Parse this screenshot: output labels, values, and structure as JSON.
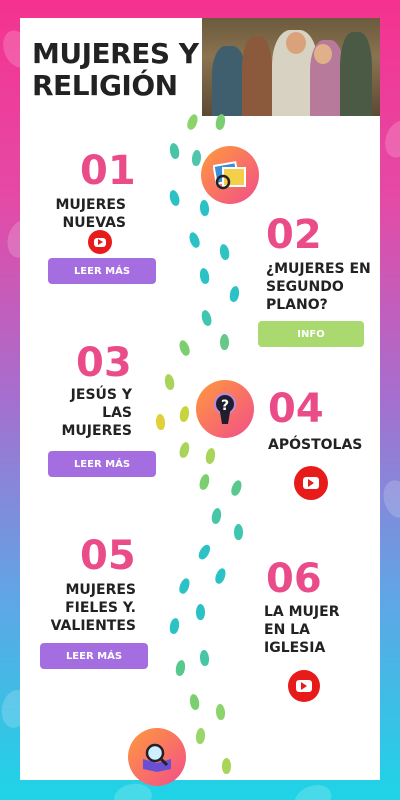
{
  "title": "MUJERES Y RELIGIÓN",
  "sections": [
    {
      "number": "01",
      "label_lines": [
        "MUJERES",
        "NUEVAS"
      ],
      "button": "LEER MÁS"
    },
    {
      "number": "02",
      "label_lines": [
        "¿MUJERES EN",
        "SEGUNDO",
        "PLANO?"
      ],
      "button": "INFO"
    },
    {
      "number": "03",
      "label_lines": [
        "JESÚS Y",
        "LAS",
        "MUJERES"
      ],
      "button": "LEER MÁS"
    },
    {
      "number": "04",
      "label_lines": [
        "APÓSTOLAS"
      ]
    },
    {
      "number": "05",
      "label_lines": [
        "MUJERES",
        "FIELES Y.",
        "VALIENTES"
      ],
      "button": "LEER MÁS"
    },
    {
      "number": "06",
      "label_lines": [
        "LA MUJER",
        "EN LA",
        "IGLESIA"
      ]
    }
  ],
  "colors": {
    "number": "#ea4c89",
    "purple_button": "#a46ee0",
    "green_button": "#a9d96f",
    "youtube": "#e81b1b"
  },
  "icons": [
    "photo-gallery-icon",
    "keyhole-icon",
    "magnifier-book-icon",
    "youtube-icon",
    "footprints-icon"
  ]
}
